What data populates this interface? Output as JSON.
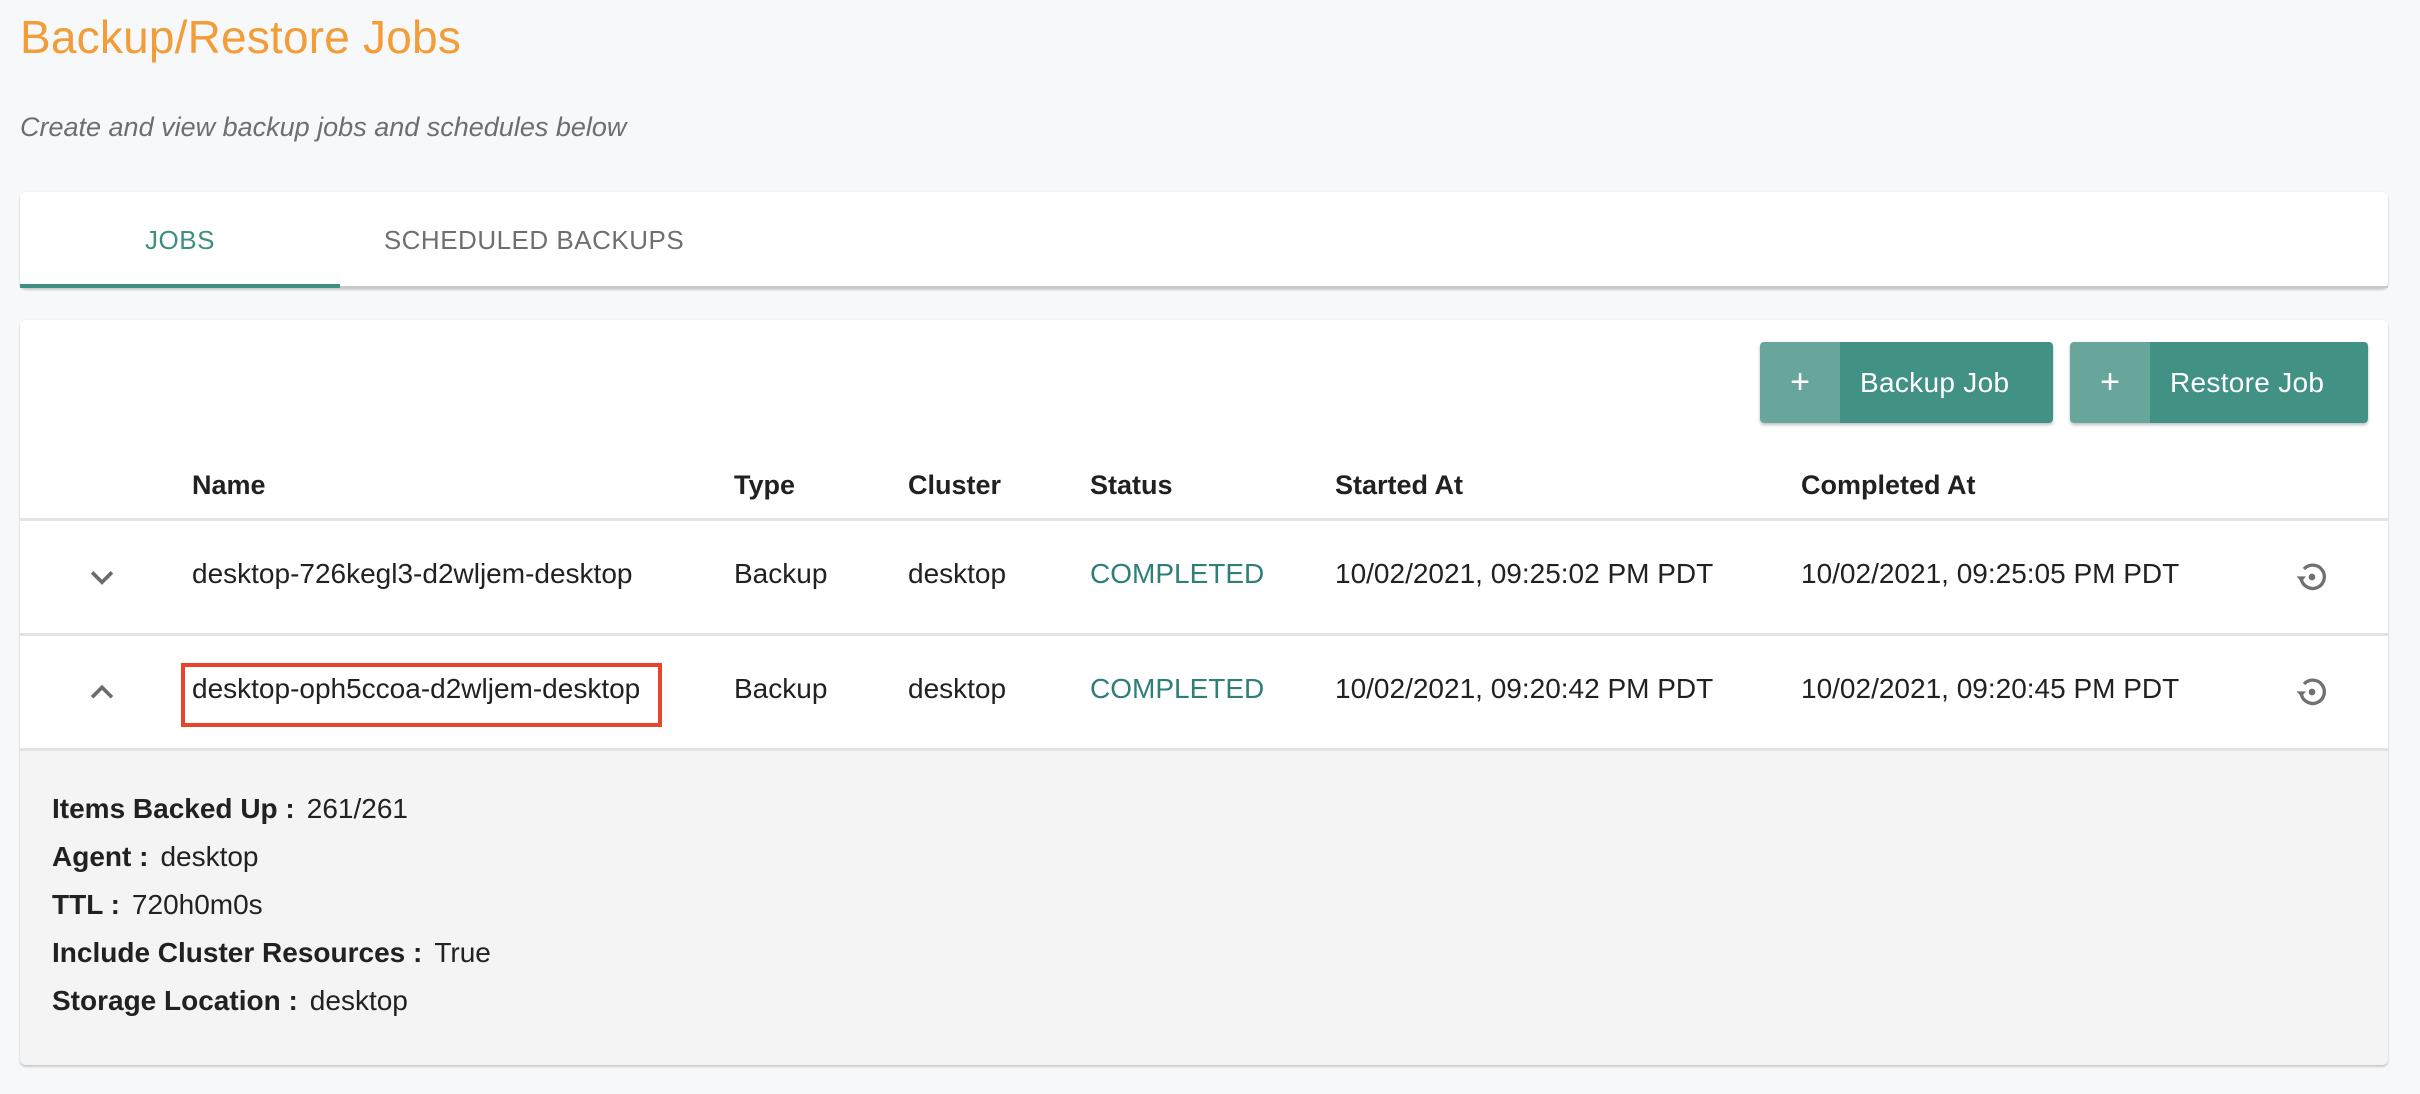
{
  "header": {
    "title": "Backup/Restore Jobs",
    "subtitle": "Create and view backup jobs and schedules below"
  },
  "tabs": [
    {
      "label": "JOBS",
      "active": true
    },
    {
      "label": "SCHEDULED BACKUPS",
      "active": false
    }
  ],
  "actions": {
    "backup_job": {
      "icon": "plus-icon",
      "label": "Backup Job"
    },
    "restore_job": {
      "icon": "plus-icon",
      "label": "Restore Job"
    }
  },
  "table": {
    "columns": [
      "Name",
      "Type",
      "Cluster",
      "Status",
      "Started At",
      "Completed At"
    ],
    "rows": [
      {
        "expanded": false,
        "name": "desktop-726kegl3-d2wljem-desktop",
        "type": "Backup",
        "cluster": "desktop",
        "status": "COMPLETED",
        "started_at": "10/02/2021, 09:25:02 PM PDT",
        "completed_at": "10/02/2021, 09:25:05 PM PDT",
        "action_icon": "restore-icon"
      },
      {
        "expanded": true,
        "highlighted": true,
        "name": "desktop-oph5ccoa-d2wljem-desktop",
        "type": "Backup",
        "cluster": "desktop",
        "status": "COMPLETED",
        "started_at": "10/02/2021, 09:20:42 PM PDT",
        "completed_at": "10/02/2021, 09:20:45 PM PDT",
        "action_icon": "restore-icon"
      }
    ],
    "details": [
      {
        "label": "Items Backed Up :",
        "value": "261/261"
      },
      {
        "label": "Agent :",
        "value": "desktop"
      },
      {
        "label": "TTL :",
        "value": "720h0m0s"
      },
      {
        "label": "Include Cluster Resources :",
        "value": "True"
      },
      {
        "label": "Storage Location :",
        "value": "desktop"
      }
    ]
  },
  "colors": {
    "title": "#f29d38",
    "accent": "#419284",
    "accent_light": "#68a69c",
    "status_completed": "#2f7f78",
    "highlight_border": "#e8432b"
  }
}
